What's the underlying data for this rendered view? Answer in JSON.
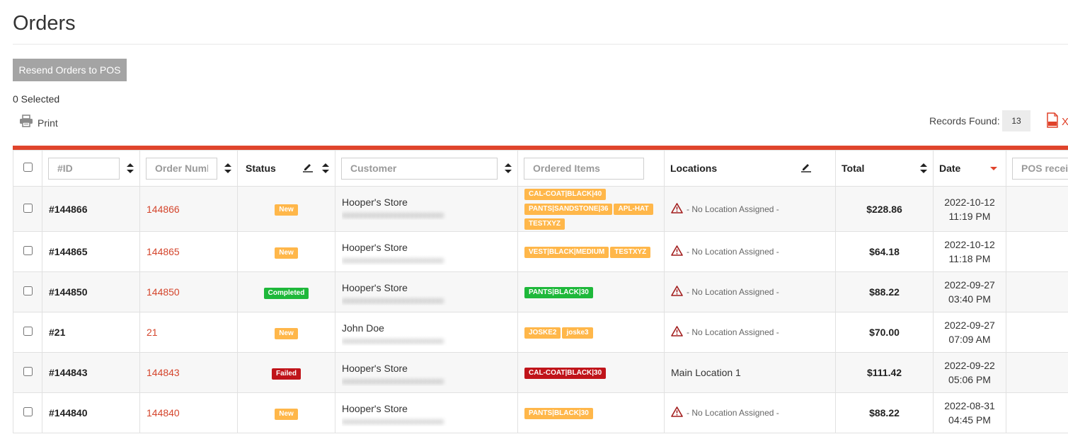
{
  "page": {
    "title": "Orders"
  },
  "toolbar": {
    "resend_label": "Resend Orders to POS",
    "selected_text": "0 Selected",
    "print_label": "Print",
    "records_label": "Records Found:",
    "records_count": "13",
    "export_label": "X"
  },
  "colors": {
    "accent": "#e0442c",
    "new": "#ffb74a",
    "completed": "#1eb83a",
    "failed": "#c0141a"
  },
  "table": {
    "headers": {
      "id_placeholder": "#ID",
      "order_placeholder": "Order Number",
      "status": "Status",
      "customer_placeholder": "Customer",
      "items_placeholder": "Ordered Items",
      "locations": "Locations",
      "total": "Total",
      "date": "Date",
      "pos_placeholder": "POS receipt"
    },
    "rows": [
      {
        "id": "#144866",
        "number": "144866",
        "status": "New",
        "status_type": "new",
        "customer": "Hooper's Store",
        "items": [
          {
            "label": "CAL-COAT|BLACK|40",
            "color": "orange"
          },
          {
            "label": "PANTS|SANDSTONE|36",
            "color": "orange"
          },
          {
            "label": "APL-HAT",
            "color": "orange"
          },
          {
            "label": "TESTXYZ",
            "color": "orange"
          }
        ],
        "location": "- No Location Assigned -",
        "location_assigned": false,
        "total": "$228.86",
        "date": "2022-10-12",
        "time": "11:19 PM",
        "pos": "-"
      },
      {
        "id": "#144865",
        "number": "144865",
        "status": "New",
        "status_type": "new",
        "customer": "Hooper's Store",
        "items": [
          {
            "label": "VEST|BLACK|MEDIUM",
            "color": "orange"
          },
          {
            "label": "TESTXYZ",
            "color": "orange"
          }
        ],
        "location": "- No Location Assigned -",
        "location_assigned": false,
        "total": "$64.18",
        "date": "2022-10-12",
        "time": "11:18 PM",
        "pos": "-"
      },
      {
        "id": "#144850",
        "number": "144850",
        "status": "Completed",
        "status_type": "completed",
        "customer": "Hooper's Store",
        "items": [
          {
            "label": "PANTS|BLACK|30",
            "color": "green"
          }
        ],
        "location": "- No Location Assigned -",
        "location_assigned": false,
        "total": "$88.22",
        "date": "2022-09-27",
        "time": "03:40 PM",
        "pos": "-"
      },
      {
        "id": "#21",
        "number": "21",
        "status": "New",
        "status_type": "new",
        "customer": "John Doe",
        "items": [
          {
            "label": "JOSKE2",
            "color": "orange"
          },
          {
            "label": "joske3",
            "color": "orange"
          }
        ],
        "location": "- No Location Assigned -",
        "location_assigned": false,
        "total": "$70.00",
        "date": "2022-09-27",
        "time": "07:09 AM",
        "pos": "-"
      },
      {
        "id": "#144843",
        "number": "144843",
        "status": "Failed",
        "status_type": "failed",
        "customer": "Hooper's Store",
        "items": [
          {
            "label": "CAL-COAT|BLACK|30",
            "color": "red"
          }
        ],
        "location": "Main Location 1",
        "location_assigned": true,
        "total": "$111.42",
        "date": "2022-09-22",
        "time": "05:06 PM",
        "pos": "-"
      },
      {
        "id": "#144840",
        "number": "144840",
        "status": "New",
        "status_type": "new",
        "customer": "Hooper's Store",
        "items": [
          {
            "label": "PANTS|BLACK|30",
            "color": "orange"
          }
        ],
        "location": "- No Location Assigned -",
        "location_assigned": false,
        "total": "$88.22",
        "date": "2022-08-31",
        "time": "04:45 PM",
        "pos": "-"
      }
    ]
  }
}
